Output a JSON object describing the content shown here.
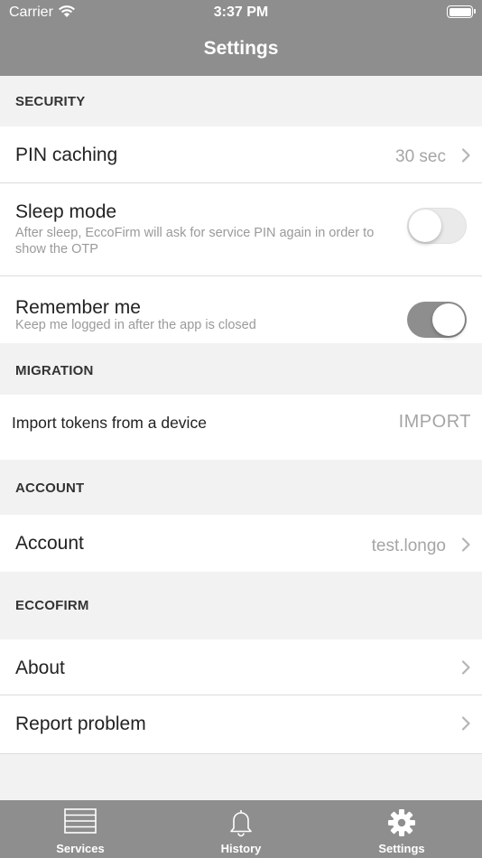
{
  "status_bar": {
    "carrier": "Carrier",
    "time": "3:37 PM"
  },
  "nav": {
    "title": "Settings"
  },
  "sections": {
    "security": {
      "header": "SECURITY",
      "pin_caching": {
        "title": "PIN caching",
        "value": "30 sec"
      },
      "sleep_mode": {
        "title": "Sleep mode",
        "subtitle": "After sleep, EccoFirm will ask for service PIN again in order to show the OTP",
        "enabled": false
      },
      "remember_me": {
        "title": "Remember me",
        "subtitle": "Keep me logged in after the app is closed",
        "enabled": true
      }
    },
    "migration": {
      "header": "MIGRATION",
      "import": {
        "label": "Import tokens from a device",
        "button": "IMPORT"
      }
    },
    "account": {
      "header": "ACCOUNT",
      "account": {
        "title": "Account",
        "value": "test.longo"
      }
    },
    "eccofirm": {
      "header": "ECCOFIRM",
      "about": {
        "title": "About"
      },
      "report": {
        "title": "Report problem"
      }
    }
  },
  "tabbar": {
    "tabs": [
      {
        "label": "Services",
        "icon": "services-list-icon"
      },
      {
        "label": "History",
        "icon": "bell-icon"
      },
      {
        "label": "Settings",
        "icon": "gear-icon",
        "selected": true
      }
    ]
  },
  "colors": {
    "bar": "#8e8e8e",
    "background": "#f2f2f2",
    "secondary_text": "#a5a5a5"
  }
}
